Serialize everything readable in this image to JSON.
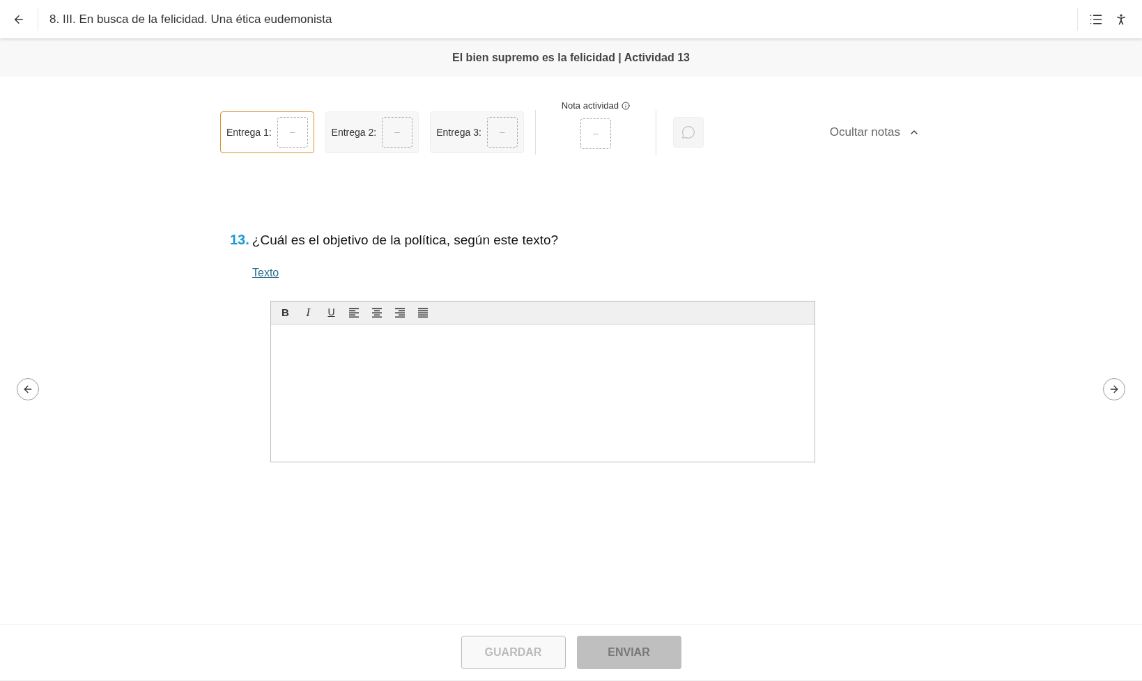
{
  "header": {
    "title": "8. III. En busca de la felicidad. Una ética eudemonista"
  },
  "subheader": {
    "title": "El bien supremo es la felicidad | Actividad 13"
  },
  "grades": {
    "submissions": [
      {
        "label": "Entrega 1:",
        "value": "–",
        "selected": true
      },
      {
        "label": "Entrega 2:",
        "value": "–",
        "selected": false
      },
      {
        "label": "Entrega 3:",
        "value": "–",
        "selected": false
      }
    ],
    "activity_grade": {
      "label": "Nota actividad",
      "value": "–"
    },
    "toggle": {
      "label": "Ocultar notas",
      "expanded": true
    }
  },
  "question": {
    "number": "13.",
    "text": "¿Cuál es el objetivo de la política, según este texto?",
    "link": "Texto"
  },
  "editor": {
    "tools": [
      {
        "kind": "bold",
        "label": "B"
      },
      {
        "kind": "italic",
        "label": "I"
      },
      {
        "kind": "underline",
        "label": "U"
      },
      {
        "kind": "align-left"
      },
      {
        "kind": "align-center"
      },
      {
        "kind": "align-right"
      },
      {
        "kind": "justify"
      }
    ]
  },
  "footer": {
    "buttons": [
      {
        "kind": "outline",
        "label": "GUARDAR",
        "disabled": true
      },
      {
        "kind": "filled",
        "label": "ENVIAR",
        "disabled": true
      }
    ]
  }
}
